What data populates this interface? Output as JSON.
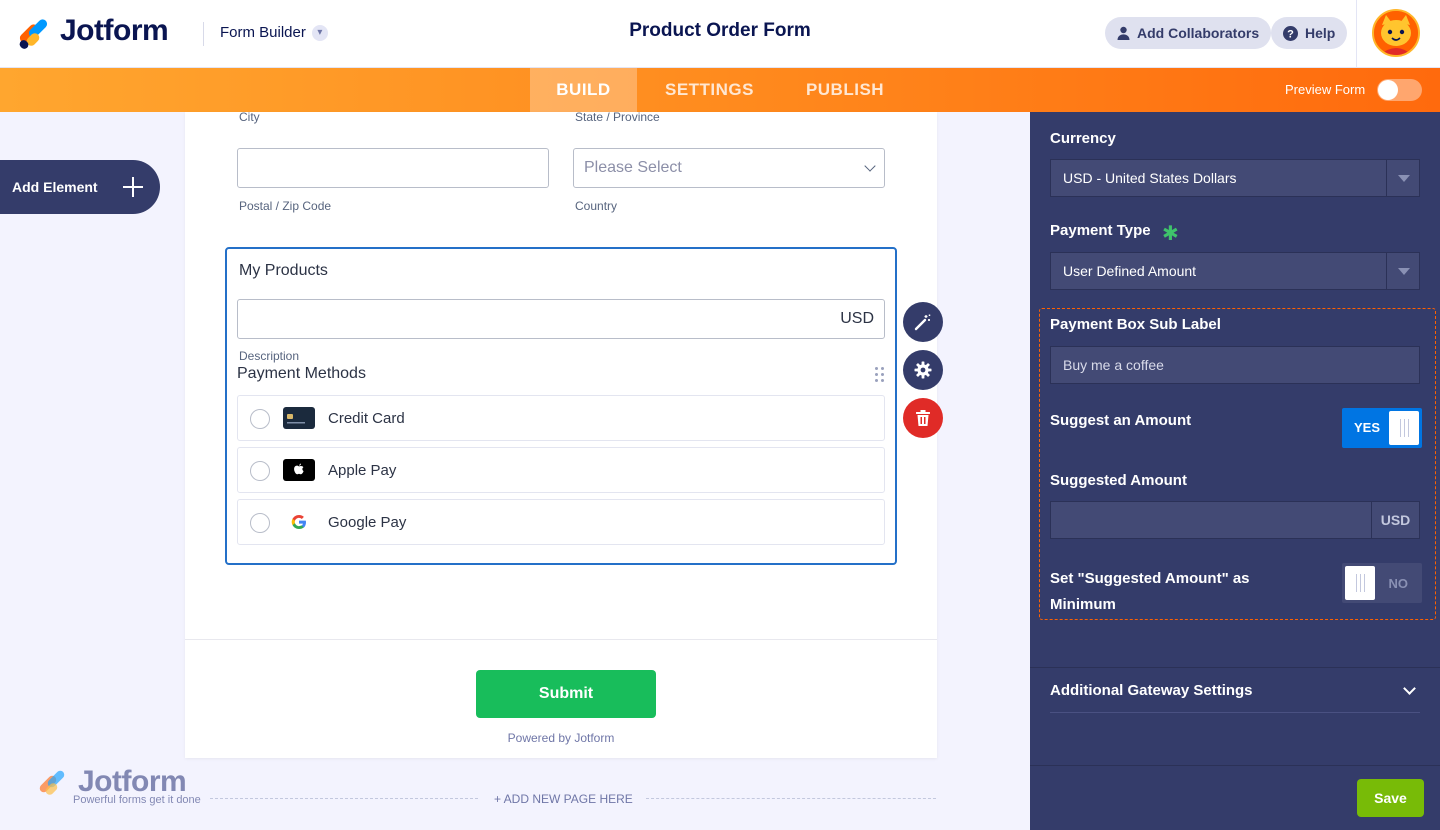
{
  "header": {
    "logo_text": "Jotform",
    "builder_label": "Form Builder",
    "form_title": "Product Order Form",
    "collaborators_label": "Add Collaborators",
    "help_label": "Help"
  },
  "nav": {
    "tabs": [
      {
        "label": "BUILD",
        "active": true
      },
      {
        "label": "SETTINGS",
        "active": false
      },
      {
        "label": "PUBLISH",
        "active": false
      }
    ],
    "preview_label": "Preview Form",
    "preview_on": false
  },
  "sidebar": {
    "add_element_label": "Add Element"
  },
  "form": {
    "city_label": "City",
    "state_label": "State / Province",
    "zip_label": "Postal / Zip Code",
    "country_placeholder": "Please Select",
    "country_label": "Country",
    "products": {
      "title": "My Products",
      "currency": "USD",
      "description_label": "Description",
      "payment_methods_title": "Payment Methods",
      "methods": [
        {
          "label": "Credit Card",
          "icon": "credit-card-icon"
        },
        {
          "label": "Apple Pay",
          "icon": "apple-icon"
        },
        {
          "label": "Google Pay",
          "icon": "google-icon"
        }
      ]
    },
    "submit_label": "Submit",
    "powered_by": "Powered by Jotform"
  },
  "bottom": {
    "logo_text": "Jotform",
    "tagline": "Powerful forms get it done",
    "add_page_label": "+ ADD NEW PAGE HERE"
  },
  "panel": {
    "currency_label": "Currency",
    "currency_value": "USD - United States Dollars",
    "payment_type_label": "Payment Type",
    "payment_type_value": "User Defined Amount",
    "sub_label_title": "Payment Box Sub Label",
    "sub_label_value": "Buy me a coffee",
    "suggest_label": "Suggest an Amount",
    "suggest_toggle": "YES",
    "suggested_amount_label": "Suggested Amount",
    "suggested_amount_currency": "USD",
    "minimum_label": "Set \"Suggested Amount\" as Minimum",
    "minimum_toggle": "NO",
    "gateway_label": "Additional Gateway Settings",
    "save_label": "Save"
  },
  "colors": {
    "brand_navy": "#0a1551",
    "nav_orange": "#ff8b1e",
    "panel_bg": "#343c6a",
    "submit_green": "#18bd5b",
    "save_green": "#78bb07",
    "toggle_blue": "#0075e3",
    "delete_red": "#e02b27",
    "highlight_orange": "#ff6100"
  }
}
